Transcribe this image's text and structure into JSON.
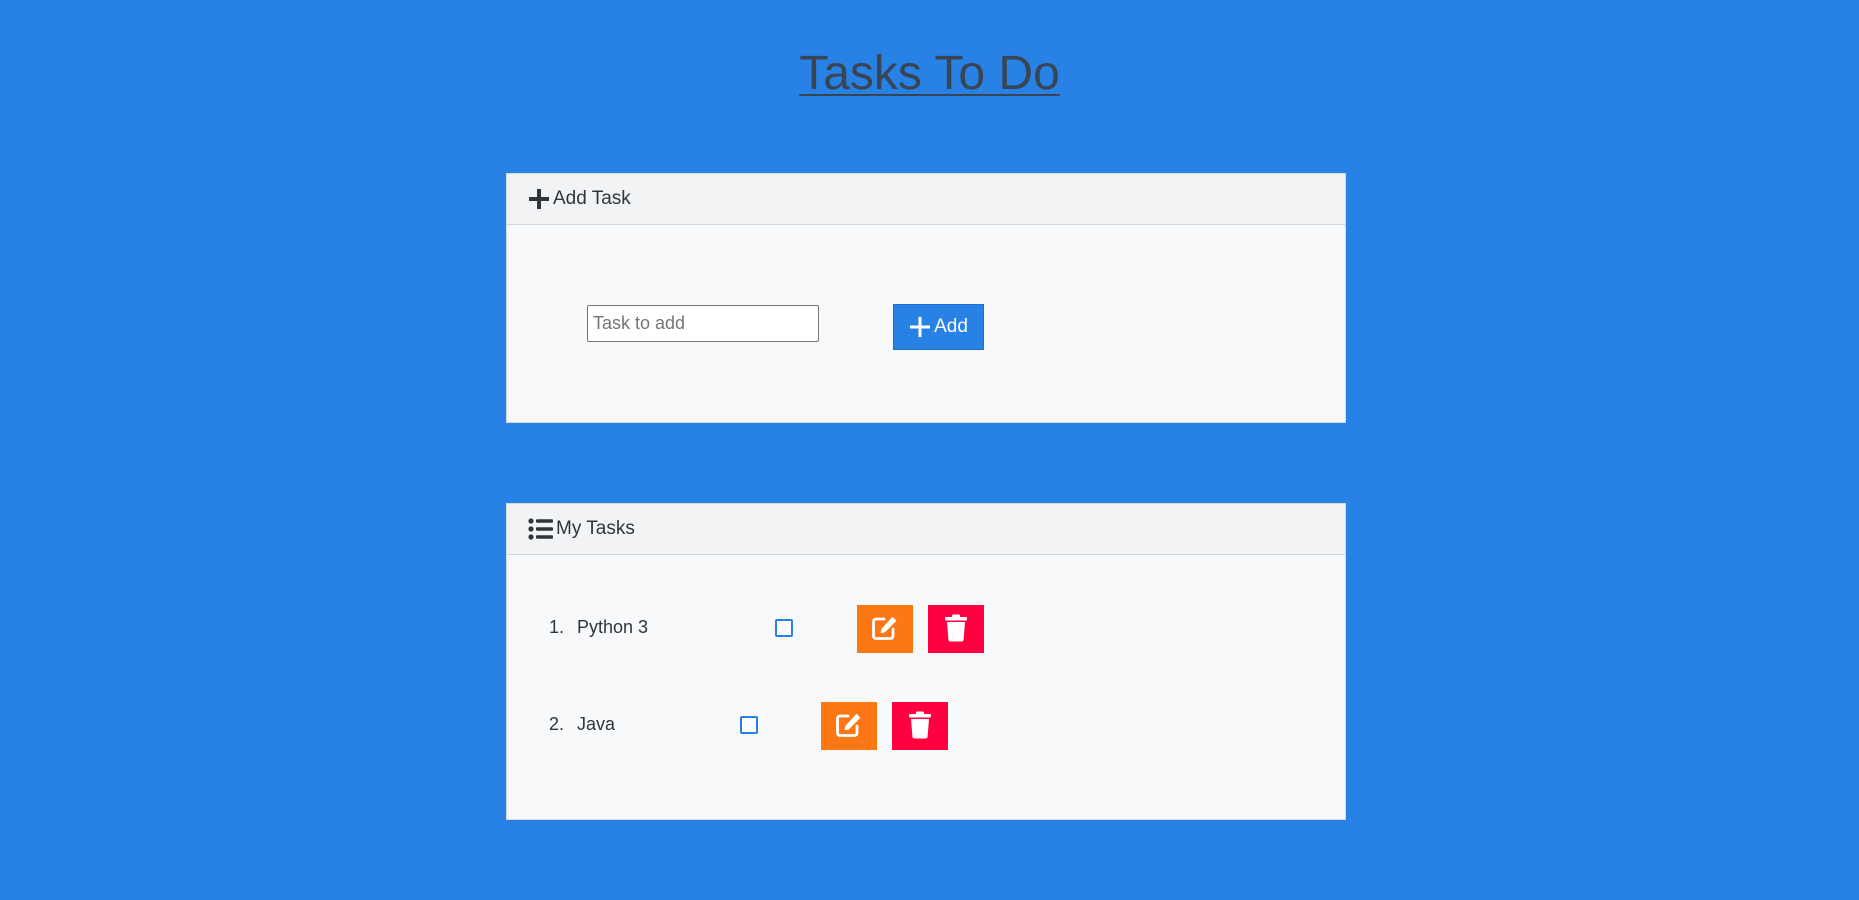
{
  "page": {
    "title": "Tasks To Do"
  },
  "add_card": {
    "header": "Add Task",
    "input_placeholder": "Task to add",
    "input_value": "",
    "add_label": "Add"
  },
  "tasks_card": {
    "header": "My Tasks",
    "tasks": [
      {
        "number": "1.",
        "name": "Python 3",
        "done": false
      },
      {
        "number": "2.",
        "name": "Java",
        "done": false
      }
    ]
  },
  "colors": {
    "background": "#2881e5",
    "edit": "#fd7714",
    "delete": "#ff0141"
  },
  "icons": {
    "add_header": "plus-icon",
    "add_button": "plus-icon",
    "tasks_header": "list-icon",
    "edit": "pencil-square-icon",
    "delete": "trash-icon"
  }
}
